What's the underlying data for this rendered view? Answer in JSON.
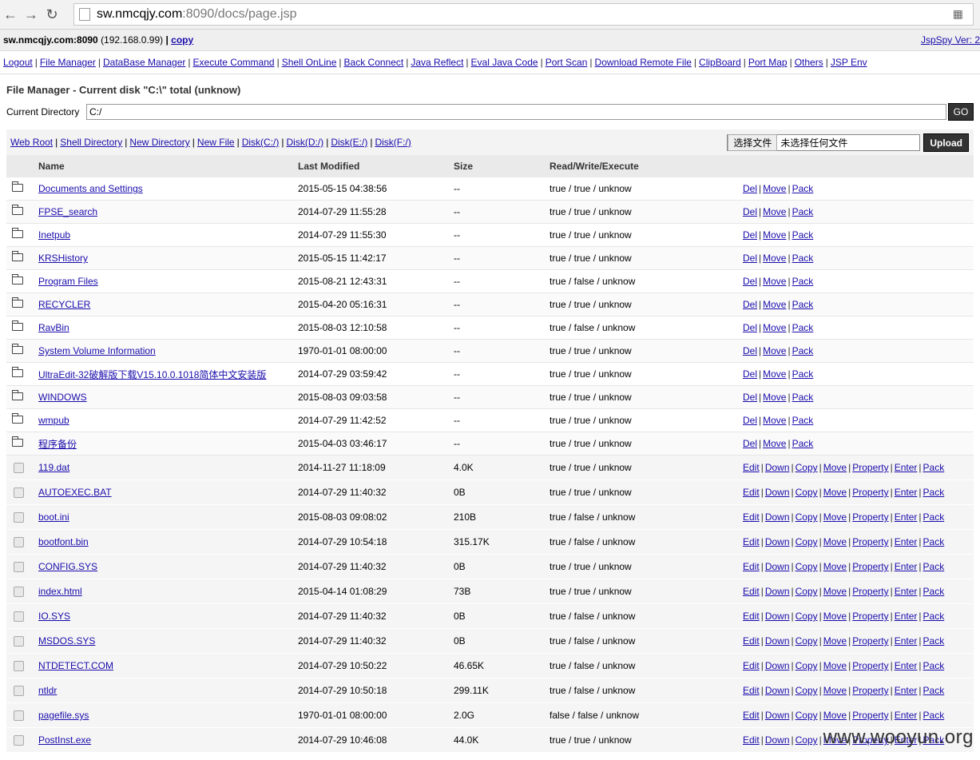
{
  "browser": {
    "url_host": "sw.nmcqjy.com",
    "url_path": ":8090/docs/page.jsp",
    "back_icon": "arrow-left",
    "forward_icon": "arrow-right",
    "reload_icon": "reload"
  },
  "info": {
    "host": "sw.nmcqjy.com:8090",
    "ip": "(192.168.0.99)",
    "pipe": "|",
    "copy_label": "copy",
    "version": "JspSpy Ver: 2"
  },
  "menu": [
    "Logout",
    "File Manager",
    "DataBase Manager",
    "Execute Command",
    "Shell OnLine",
    "Back Connect",
    "Java Reflect",
    "Eval Java Code",
    "Port Scan",
    "Download Remote File",
    "ClipBoard",
    "Port Map",
    "Others",
    "JSP Env"
  ],
  "title": "File Manager - Current disk \"C:\\\" total (unknow)",
  "current_dir": {
    "label": "Current Directory",
    "value": "C:/",
    "go": "GO"
  },
  "links": [
    "Web Root",
    "Shell Directory",
    "New Directory",
    "New File",
    "Disk(C:/)",
    "Disk(D:/)",
    "Disk(E:/)",
    "Disk(F:/)"
  ],
  "upload": {
    "choose": "选择文件",
    "none": "未选择任何文件",
    "button": "Upload"
  },
  "columns": [
    "Name",
    "Last Modified",
    "Size",
    "Read/Write/Execute"
  ],
  "dir_actions": [
    "Del",
    "Move",
    "Pack"
  ],
  "file_actions": [
    "Edit",
    "Down",
    "Copy",
    "Move",
    "Property",
    "Enter",
    "Pack"
  ],
  "dirs": [
    {
      "name": "Documents and Settings",
      "modified": "2015-05-15 04:38:56",
      "size": "--",
      "rwx": "true / true / unknow"
    },
    {
      "name": "FPSE_search",
      "modified": "2014-07-29 11:55:28",
      "size": "--",
      "rwx": "true / true / unknow"
    },
    {
      "name": "Inetpub",
      "modified": "2014-07-29 11:55:30",
      "size": "--",
      "rwx": "true / true / unknow"
    },
    {
      "name": "KRSHistory",
      "modified": "2015-05-15 11:42:17",
      "size": "--",
      "rwx": "true / true / unknow"
    },
    {
      "name": "Program Files",
      "modified": "2015-08-21 12:43:31",
      "size": "--",
      "rwx": "true / false / unknow"
    },
    {
      "name": "RECYCLER",
      "modified": "2015-04-20 05:16:31",
      "size": "--",
      "rwx": "true / true / unknow"
    },
    {
      "name": "RavBin",
      "modified": "2015-08-03 12:10:58",
      "size": "--",
      "rwx": "true / false / unknow"
    },
    {
      "name": "System Volume Information",
      "modified": "1970-01-01 08:00:00",
      "size": "--",
      "rwx": "true / true / unknow"
    },
    {
      "name": "UltraEdit-32破解版下载V15.10.0.1018简体中文安装版",
      "modified": "2014-07-29 03:59:42",
      "size": "--",
      "rwx": "true / true / unknow"
    },
    {
      "name": "WINDOWS",
      "modified": "2015-08-03 09:03:58",
      "size": "--",
      "rwx": "true / true / unknow"
    },
    {
      "name": "wmpub",
      "modified": "2014-07-29 11:42:52",
      "size": "--",
      "rwx": "true / true / unknow"
    },
    {
      "name": "程序备份",
      "modified": "2015-04-03 03:46:17",
      "size": "--",
      "rwx": "true / true / unknow"
    }
  ],
  "files": [
    {
      "name": "119.dat",
      "modified": "2014-11-27 11:18:09",
      "size": "4.0K",
      "rwx": "true / true / unknow"
    },
    {
      "name": "AUTOEXEC.BAT",
      "modified": "2014-07-29 11:40:32",
      "size": "0B",
      "rwx": "true / true / unknow"
    },
    {
      "name": "boot.ini",
      "modified": "2015-08-03 09:08:02",
      "size": "210B",
      "rwx": "true / false / unknow"
    },
    {
      "name": "bootfont.bin",
      "modified": "2014-07-29 10:54:18",
      "size": "315.17K",
      "rwx": "true / false / unknow"
    },
    {
      "name": "CONFIG.SYS",
      "modified": "2014-07-29 11:40:32",
      "size": "0B",
      "rwx": "true / true / unknow"
    },
    {
      "name": "index.html",
      "modified": "2015-04-14 01:08:29",
      "size": "73B",
      "rwx": "true / true / unknow"
    },
    {
      "name": "IO.SYS",
      "modified": "2014-07-29 11:40:32",
      "size": "0B",
      "rwx": "true / false / unknow"
    },
    {
      "name": "MSDOS.SYS",
      "modified": "2014-07-29 11:40:32",
      "size": "0B",
      "rwx": "true / false / unknow"
    },
    {
      "name": "NTDETECT.COM",
      "modified": "2014-07-29 10:50:22",
      "size": "46.65K",
      "rwx": "true / false / unknow"
    },
    {
      "name": "ntldr",
      "modified": "2014-07-29 10:50:18",
      "size": "299.11K",
      "rwx": "true / false / unknow"
    },
    {
      "name": "pagefile.sys",
      "modified": "1970-01-01 08:00:00",
      "size": "2.0G",
      "rwx": "false / false / unknow"
    },
    {
      "name": "PostInst.exe",
      "modified": "2014-07-29 10:46:08",
      "size": "44.0K",
      "rwx": "true / true / unknow"
    }
  ],
  "watermark": "www.wooyun.org"
}
